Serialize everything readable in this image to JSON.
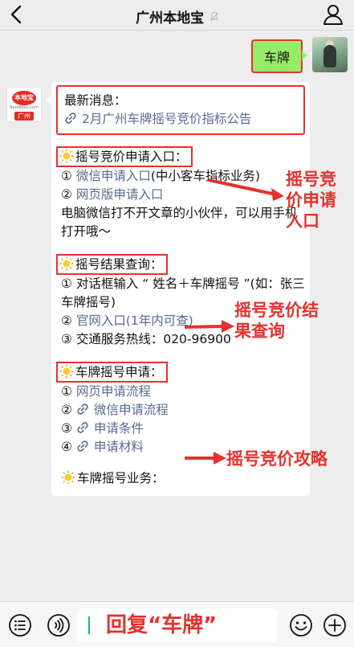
{
  "navbar": {
    "back_glyph": "‹",
    "title": "广州本地宝",
    "mute_glyph": "🔇"
  },
  "outgoing": {
    "text": "车牌"
  },
  "avatar": {
    "logo": "本地宝",
    "logo_sub": "Bendibao.com",
    "city": "广州"
  },
  "message": {
    "news_title": "最新消息：",
    "news_link": "2月广州车牌摇号竞价指标公告",
    "sections": [
      {
        "title": "摇号竞价申请入口：",
        "lines": [
          {
            "prefix": "① ",
            "link": "微信申请入口",
            "suffix": "(中小客车指标业务)"
          },
          {
            "prefix": "② ",
            "link": "网页版申请入口",
            "suffix": ""
          },
          {
            "prefix": "",
            "link": "",
            "suffix": "电脑微信打不开文章的小伙伴，可以用手机打开哦～"
          }
        ]
      },
      {
        "title": "摇号结果查询：",
        "lines": [
          {
            "prefix": "① ",
            "link": "",
            "suffix": "对话框输入 “ 姓名＋车牌摇号 ”(如：张三车牌摇号)"
          },
          {
            "prefix": "② ",
            "link": "官网入口(1年内可查)",
            "suffix": ""
          },
          {
            "prefix": "③ ",
            "link": "",
            "suffix": "交通服务热线：020-96900"
          }
        ]
      },
      {
        "title": "车牌摇号申请：",
        "lines": [
          {
            "prefix": "① ",
            "link": "网页申请流程",
            "suffix": "",
            "chain": false
          },
          {
            "prefix": "② ",
            "link": "微信申请流程",
            "suffix": "",
            "chain": true
          },
          {
            "prefix": "③ ",
            "link": "申请条件",
            "suffix": "",
            "chain": true
          },
          {
            "prefix": "④ ",
            "link": "申请材料",
            "suffix": "",
            "chain": true
          }
        ]
      },
      {
        "title": "车牌摇号业务：",
        "lines": []
      }
    ]
  },
  "annotations": {
    "a1": "摇号竞价申请入口",
    "a2": "摇号竞价结果查询",
    "a3": "摇号竞价攻略"
  },
  "input": {
    "text": "回复“车牌”"
  },
  "colors": {
    "accent_red": "#e5322d",
    "link_blue": "#576b95",
    "bubble_green": "#95ec69"
  }
}
